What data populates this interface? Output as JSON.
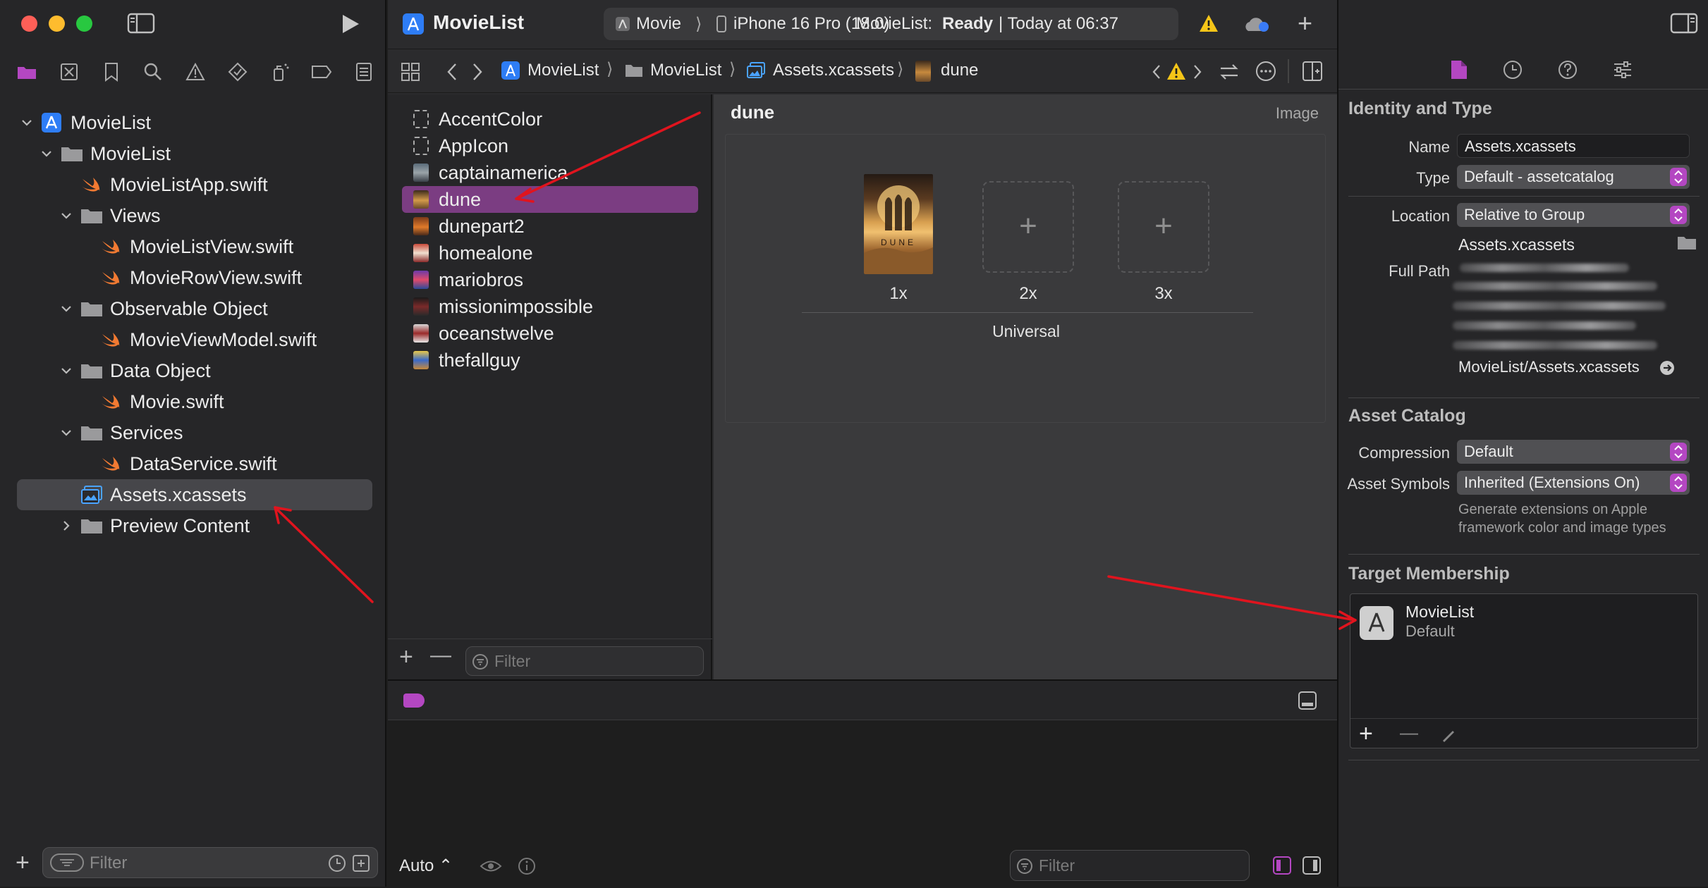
{
  "colors": {
    "accent": "#b447c2",
    "selection": "#7b3d82",
    "arrow": "#e0141e",
    "warning": "#f5c518",
    "swift": "#f27a32"
  },
  "titlebar": {
    "app_title": "MovieList",
    "scheme_name": "Movie",
    "destination": "iPhone 16 Pro (18.0)",
    "status_project": "MovieList:",
    "status_state": "Ready",
    "status_time": "| Today at 06:37"
  },
  "jumpbar": {
    "crumbs": [
      "MovieList",
      "MovieList",
      "Assets.xcassets",
      "dune"
    ]
  },
  "navigator": {
    "tree": [
      {
        "label": "MovieList",
        "kind": "project"
      },
      {
        "label": "MovieList",
        "kind": "folder"
      },
      {
        "label": "MovieListApp.swift",
        "kind": "swift"
      },
      {
        "label": "Views",
        "kind": "folder"
      },
      {
        "label": "MovieListView.swift",
        "kind": "swift"
      },
      {
        "label": "MovieRowView.swift",
        "kind": "swift"
      },
      {
        "label": "Observable Object",
        "kind": "folder"
      },
      {
        "label": "MovieViewModel.swift",
        "kind": "swift"
      },
      {
        "label": "Data Object",
        "kind": "folder"
      },
      {
        "label": "Movie.swift",
        "kind": "swift"
      },
      {
        "label": "Services",
        "kind": "folder"
      },
      {
        "label": "DataService.swift",
        "kind": "swift"
      },
      {
        "label": "Assets.xcassets",
        "kind": "assets",
        "selected": true
      },
      {
        "label": "Preview Content",
        "kind": "folder"
      }
    ],
    "filter_placeholder": "Filter"
  },
  "asset_catalog": {
    "assets": [
      {
        "label": "AccentColor",
        "kind": "color"
      },
      {
        "label": "AppIcon",
        "kind": "icon"
      },
      {
        "label": "captainamerica",
        "kind": "image"
      },
      {
        "label": "dune",
        "kind": "image",
        "selected": true
      },
      {
        "label": "dunepart2",
        "kind": "image"
      },
      {
        "label": "homealone",
        "kind": "image"
      },
      {
        "label": "mariobros",
        "kind": "image"
      },
      {
        "label": "missionimpossible",
        "kind": "image"
      },
      {
        "label": "oceanstwelve",
        "kind": "image"
      },
      {
        "label": "thefallguy",
        "kind": "image"
      }
    ],
    "filter_placeholder": "Filter"
  },
  "image_set": {
    "name": "dune",
    "kind": "Image",
    "poster_text": "DUNE",
    "slots": [
      "1x",
      "2x",
      "3x"
    ],
    "idiom": "Universal",
    "plus_glyph": "+"
  },
  "debug": {
    "scope_label": "Auto ⌃",
    "filter_placeholder": "Filter"
  },
  "inspector": {
    "identity_title": "Identity and Type",
    "name_label": "Name",
    "name_value": "Assets.xcassets",
    "type_label": "Type",
    "type_value": "Default - assetcatalog",
    "location_label": "Location",
    "location_value": "Relative to Group",
    "location_file": "Assets.xcassets",
    "fullpath_label": "Full Path",
    "fullpath_tail": "MovieList/Assets.xcassets",
    "catalog_title": "Asset Catalog",
    "compression_label": "Compression",
    "compression_value": "Default",
    "symbols_label": "Asset Symbols",
    "symbols_value": "Inherited (Extensions On)",
    "symbols_help_1": "Generate extensions on Apple",
    "symbols_help_2": "framework color and image types",
    "membership_title": "Target Membership",
    "target_name": "MovieList",
    "target_sub": "Default",
    "foot_add": "+",
    "foot_remove": "—"
  }
}
